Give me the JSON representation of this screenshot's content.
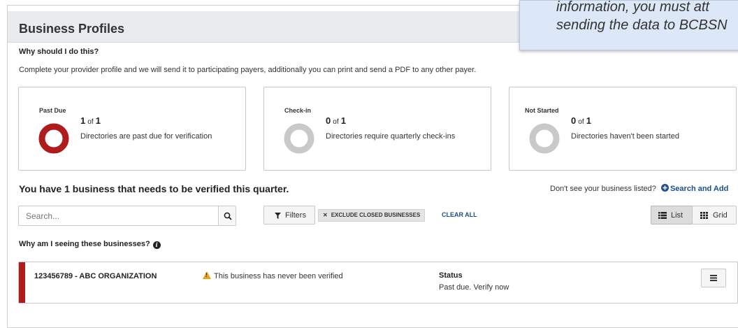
{
  "panel": {
    "title": "Business Profiles"
  },
  "tooltip": {
    "line1": "information, you must att",
    "line2": "sending the data to BCBSN"
  },
  "intro": {
    "why_title": "Why should I do this?",
    "description": "Complete your provider profile and we will send it to participating payers, additionally you can print and send a PDF to any other payer."
  },
  "cards": [
    {
      "label": "Past Due",
      "count": "1",
      "of": "of",
      "total": "1",
      "description": "Directories are past due for verification",
      "fraction": 1.0,
      "color": "#b01c1c"
    },
    {
      "label": "Check-in",
      "count": "0",
      "of": "of",
      "total": "1",
      "description": "Directories require quarterly check-ins",
      "fraction": 0.0,
      "color": "#c9c9c9"
    },
    {
      "label": "Not Started",
      "count": "0",
      "of": "of",
      "total": "1",
      "description": "Directories haven't been started",
      "fraction": 0.0,
      "color": "#c9c9c9"
    }
  ],
  "headline": "You have 1 business that needs to be verified this quarter.",
  "dont_see": {
    "text": "Don't see your business listed?",
    "link": "Search and Add"
  },
  "search": {
    "placeholder": "Search..."
  },
  "filters": {
    "button": "Filters",
    "chip": "EXCLUDE CLOSED BUSINESSES",
    "clear": "CLEAR ALL"
  },
  "view": {
    "list": "List",
    "grid": "Grid",
    "active": "list"
  },
  "why_seeing": "Why am I seeing these businesses?",
  "businesses": [
    {
      "name": "123456789 - ABC ORGANIZATION",
      "warning": "This business has never been verified",
      "status_label": "Status",
      "status_value": "Past due. Verify now"
    }
  ],
  "colors": {
    "accent": "#1b4f8f",
    "past_due": "#b01c1c",
    "warning": "#e8a317"
  }
}
